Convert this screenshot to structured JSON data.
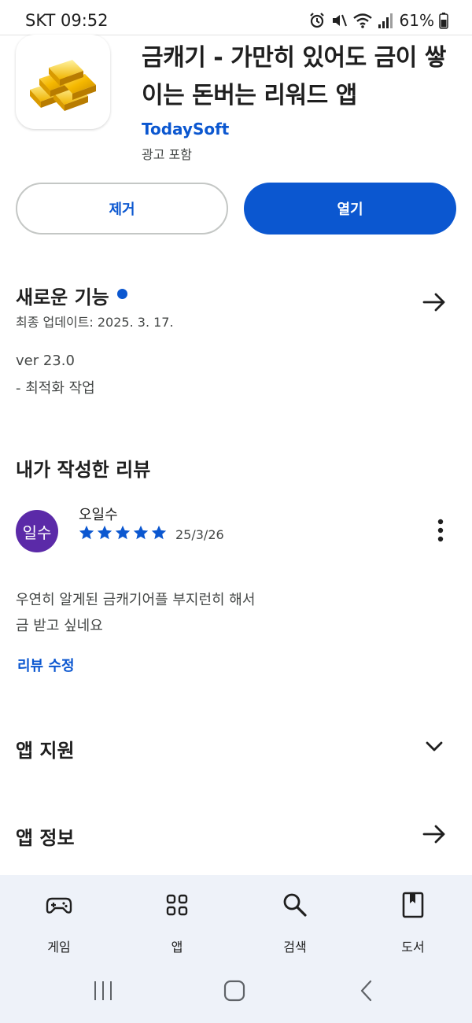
{
  "status_bar": {
    "carrier_time": "SKT 09:52",
    "battery": "61%"
  },
  "app": {
    "title": "금캐기 - 가만히 있어도 금이 쌓이는 돈버는 리워드 앱",
    "developer": "TodaySoft",
    "ad_label": "광고 포함"
  },
  "buttons": {
    "uninstall": "제거",
    "open": "열기"
  },
  "whats_new": {
    "title": "새로운 기능",
    "last_updated": "최종 업데이트: 2025. 3. 17.",
    "version": "ver 23.0",
    "notes": "- 최적화 작업"
  },
  "my_review": {
    "title": "내가 작성한 리뷰",
    "avatar_text": "일수",
    "avatar_color": "#5b2aa8",
    "reviewer": "오일수",
    "rating": 5,
    "date": "25/3/26",
    "text_line1": "우연히 알게된 금캐기어플 부지런히 해서",
    "text_line2": "금 받고 싶네요",
    "edit_label": "리뷰 수정"
  },
  "sections": {
    "app_support": "앱 지원",
    "app_info": "앱 정보"
  },
  "bottom_nav": {
    "items": [
      {
        "label": "게임",
        "icon": "gamepad-icon"
      },
      {
        "label": "앱",
        "icon": "apps-grid-icon"
      },
      {
        "label": "검색",
        "icon": "search-icon"
      },
      {
        "label": "도서",
        "icon": "book-icon"
      }
    ]
  },
  "colors": {
    "accent": "#0b57d0",
    "nav_background": "#eef2f9"
  }
}
